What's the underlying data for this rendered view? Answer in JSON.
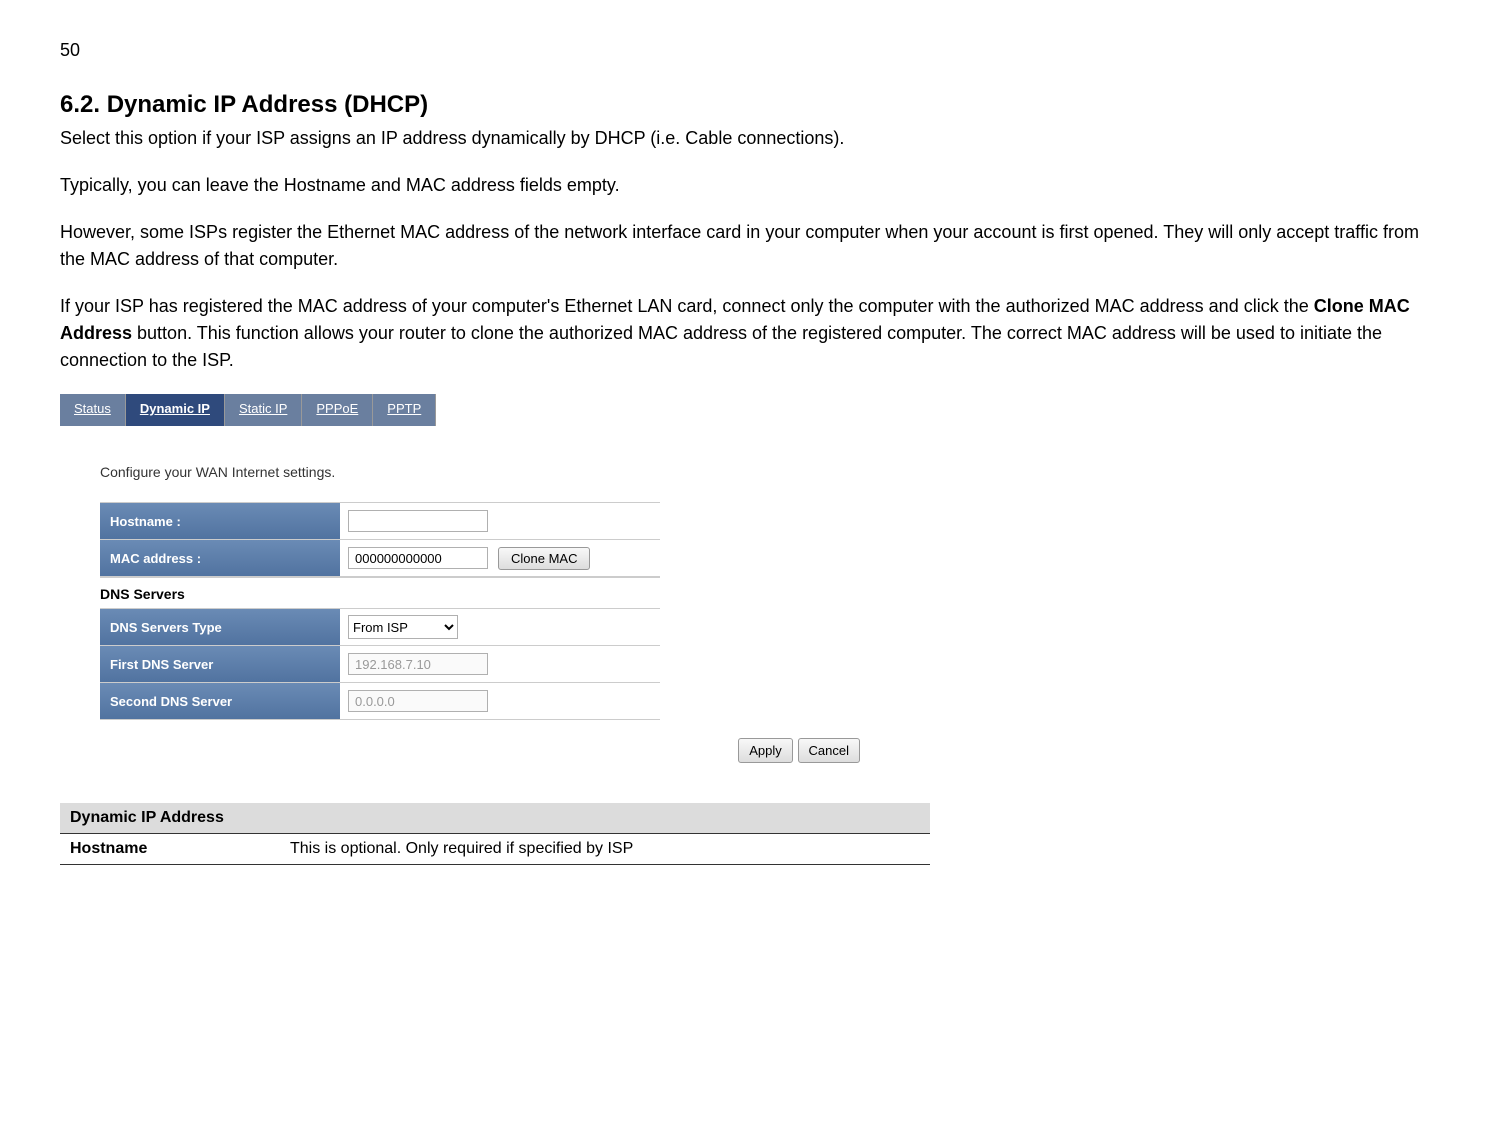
{
  "page_number": "50",
  "heading": "6.2.    Dynamic IP Address (DHCP)",
  "para1": "Select this option if your ISP assigns an IP address dynamically by DHCP (i.e. Cable connections).",
  "para2": "Typically, you can leave the Hostname and MAC address fields empty.",
  "para3": "However, some ISPs register the Ethernet MAC address of the network interface card in your computer when your account is first opened. They will only accept traffic from the MAC address of that computer.",
  "para4a": "If your ISP has registered the MAC address of your computer's Ethernet LAN card, connect only the computer with the authorized MAC address and click the ",
  "para4b": "Clone MAC Address",
  "para4c": " button. This function allows your router to clone the authorized MAC address of the registered computer. The correct MAC address will be used to initiate the connection to the ISP.",
  "tabs": {
    "status": "Status",
    "dynamic_ip": "Dynamic IP",
    "static_ip": "Static IP",
    "pppoe": "PPPoE",
    "pptp": "PPTP"
  },
  "subtext": "Configure your WAN Internet settings.",
  "form": {
    "hostname_label": "Hostname :",
    "hostname_value": "",
    "mac_label": "MAC address :",
    "mac_value": "000000000000",
    "clone_mac": "Clone MAC",
    "dns_section": "DNS Servers",
    "dns_type_label": "DNS Servers Type",
    "dns_type_value": "From ISP",
    "first_dns_label": "First DNS Server",
    "first_dns_value": "192.168.7.10",
    "second_dns_label": "Second DNS Server",
    "second_dns_value": "0.0.0.0"
  },
  "buttons": {
    "apply": "Apply",
    "cancel": "Cancel"
  },
  "desc_table": {
    "title": "Dynamic IP Address",
    "row1_key": "Hostname",
    "row1_val": "This is optional. Only required if specified by ISP"
  }
}
